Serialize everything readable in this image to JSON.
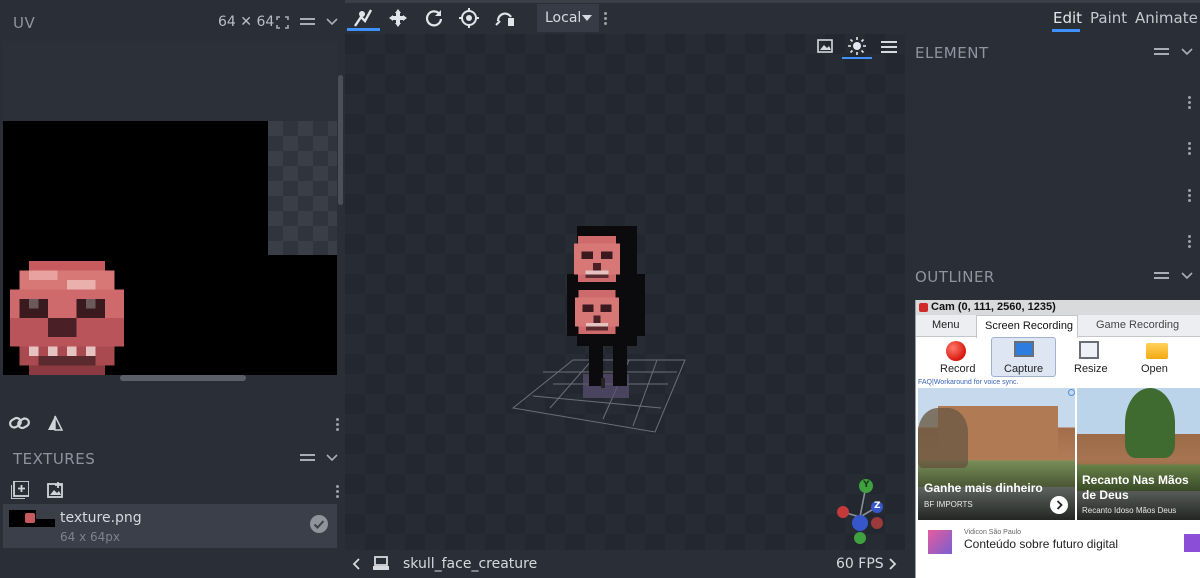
{
  "uv_panel": {
    "title": "UV",
    "size_label": "64 ✕ 64"
  },
  "textures_panel": {
    "title": "TEXTURES",
    "texture": {
      "name": "texture.png",
      "size": "64 x 64px"
    }
  },
  "toolbar": {
    "space_select": "Local"
  },
  "modes": {
    "edit": "Edit",
    "paint": "Paint",
    "animate": "Animate"
  },
  "element_panel": {
    "title": "ELEMENT"
  },
  "outliner_panel": {
    "title": "OUTLINER"
  },
  "viewport": {
    "model_name": "skull_face_creature",
    "fps": "60 FPS",
    "gizmo": {
      "y": "Y",
      "z": "Z"
    }
  },
  "bandicam": {
    "title": "Cam (0, 111, 2560, 1235)",
    "tabs": [
      "Menu",
      "Screen Recording",
      "Game Recording"
    ],
    "tools": [
      "Record",
      "Capture",
      "Resize",
      "Open"
    ],
    "faq": "FAQ|Workaround for voice sync.",
    "ads": [
      {
        "title": "Ganhe mais dinheiro",
        "source": "BF IMPORTS"
      },
      {
        "title": "Recanto Nas Mãos de Deus",
        "source": "Recanto Idoso Mãos Deus"
      }
    ],
    "bottom_ad": {
      "source": "Vidicon São Paulo",
      "title": "Conteúdo sobre futuro digital"
    }
  },
  "colors": {
    "panel_bg": "#2a2e37",
    "viewport_bg": "#23272f",
    "accent": "#3e90ff",
    "text": "#a8adb8"
  }
}
